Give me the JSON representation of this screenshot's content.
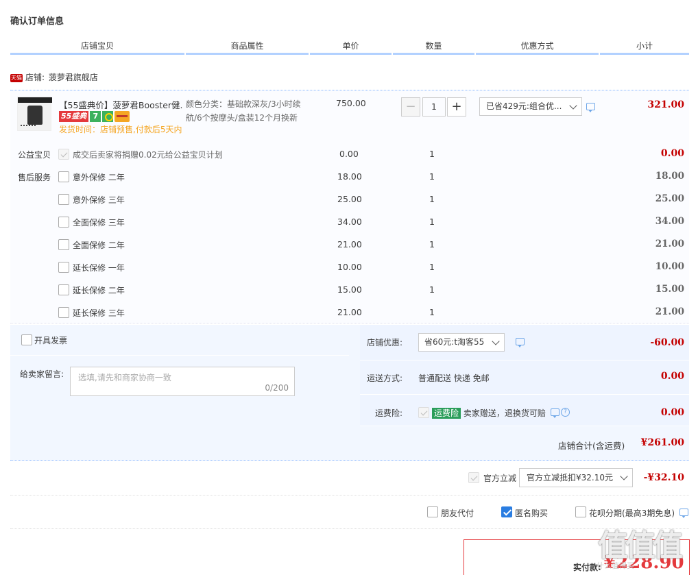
{
  "page": {
    "title": "确认订单信息"
  },
  "columns": [
    "店铺宝贝",
    "商品属性",
    "单价",
    "数量",
    "优惠方式",
    "小计"
  ],
  "shop": {
    "tag": "天猫",
    "label": "店铺:",
    "name": "菠萝君旗舰店"
  },
  "product": {
    "name": "【55盛典价】菠萝君Booster健...",
    "badge_55": "55盛典",
    "badge_7": "7",
    "ship_time": "发货时间：店铺预售,付款后5天内",
    "attrs": "颜色分类：基础款深灰/3小时续航/6个按摩头/盒装12个月换新",
    "unit_price": "750.00",
    "qty": "1",
    "qty_minus": "−",
    "qty_plus": "+",
    "discount": "已省429元:组合优...",
    "subtotal": "321.00"
  },
  "charity": {
    "label": "公益宝贝",
    "text": "成交后卖家将捐赠0.02元给公益宝贝计划",
    "price": "0.00",
    "qty": "1",
    "subtotal": "0.00"
  },
  "after_sales": {
    "label": "售后服务",
    "items": [
      {
        "name": "意外保修 二年",
        "price": "18.00",
        "qty": "1",
        "subtotal": "18.00"
      },
      {
        "name": "意外保修 三年",
        "price": "25.00",
        "qty": "1",
        "subtotal": "25.00"
      },
      {
        "name": "全面保修 三年",
        "price": "34.00",
        "qty": "1",
        "subtotal": "34.00"
      },
      {
        "name": "全面保修 二年",
        "price": "21.00",
        "qty": "1",
        "subtotal": "21.00"
      },
      {
        "name": "延长保修 一年",
        "price": "10.00",
        "qty": "1",
        "subtotal": "10.00"
      },
      {
        "name": "延长保修 二年",
        "price": "15.00",
        "qty": "1",
        "subtotal": "15.00"
      },
      {
        "name": "延长保修 三年",
        "price": "21.00",
        "qty": "1",
        "subtotal": "21.00"
      }
    ]
  },
  "invoice": {
    "label": "开具发票"
  },
  "message": {
    "label": "给卖家留言:",
    "placeholder": "选填,请先和商家协商一致",
    "count": "0/200"
  },
  "shop_discount": {
    "label": "店铺优惠:",
    "value": "省60元:t淘客55",
    "amount": "-60.00"
  },
  "shipping": {
    "label": "运送方式:",
    "value": "普通配送 快递 免邮",
    "amount": "0.00"
  },
  "insurance": {
    "label": "运费险:",
    "tag": "运费险",
    "text": "卖家赠送，退换货可赔",
    "amount": "0.00"
  },
  "shop_total": {
    "label": "店铺合计(含运费)",
    "amount": "¥261.00"
  },
  "gov_discount": {
    "label": "官方立减",
    "value": "官方立减抵扣¥32.10元",
    "amount": "-¥32.10"
  },
  "options": {
    "friend_pay": "朋友代付",
    "anonymous": "匿名购买",
    "huabei": "花呗分期(最高3期免息)"
  },
  "payment": {
    "label": "实付款:",
    "amount": "¥228.90"
  },
  "watermark": {
    "text": "值值值",
    "url": "什么值得买"
  },
  "colors": {
    "accent": "#c40000",
    "link_blue": "#2a7de1",
    "header_border": "#b2d1ff"
  }
}
